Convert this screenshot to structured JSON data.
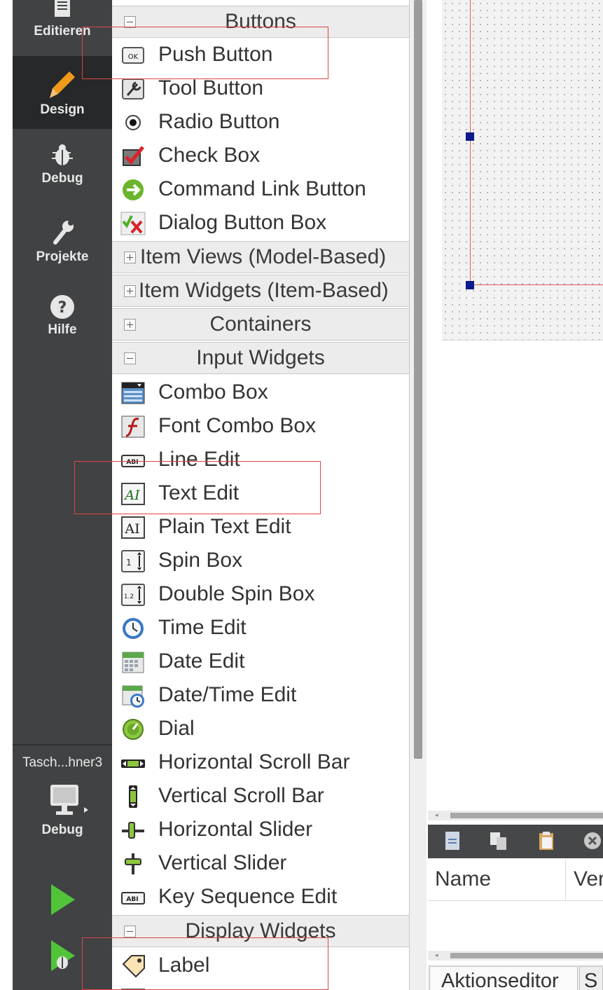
{
  "modes": [
    {
      "label": "Editieren",
      "icon": "document-icon"
    },
    {
      "label": "Design",
      "icon": "pencil-icon"
    },
    {
      "label": "Debug",
      "icon": "bug-icon"
    },
    {
      "label": "Projekte",
      "icon": "wrench-icon"
    },
    {
      "label": "Hilfe",
      "icon": "help-icon"
    }
  ],
  "kit": {
    "project_name": "Tasch...hner3",
    "build_mode": "Debug"
  },
  "widget_box": {
    "categories": {
      "buttons": "Buttons",
      "item_views": "Item Views (Model-Based)",
      "item_widgets": "Item Widgets (Item-Based)",
      "containers": "Containers",
      "input_widgets": "Input Widgets",
      "display_widgets": "Display Widgets"
    },
    "buttons": [
      {
        "label": "Push Button",
        "icon": "push-button-icon"
      },
      {
        "label": "Tool Button",
        "icon": "tool-button-icon"
      },
      {
        "label": "Radio Button",
        "icon": "radio-button-icon"
      },
      {
        "label": "Check Box",
        "icon": "check-box-icon"
      },
      {
        "label": "Command Link Button",
        "icon": "command-link-icon"
      },
      {
        "label": "Dialog Button Box",
        "icon": "dialog-button-box-icon"
      }
    ],
    "input_widgets": [
      {
        "label": "Combo Box",
        "icon": "combo-box-icon"
      },
      {
        "label": "Font Combo Box",
        "icon": "font-combo-box-icon"
      },
      {
        "label": "Line Edit",
        "icon": "line-edit-icon"
      },
      {
        "label": "Text Edit",
        "icon": "text-edit-icon"
      },
      {
        "label": "Plain Text Edit",
        "icon": "plain-text-edit-icon"
      },
      {
        "label": "Spin Box",
        "icon": "spin-box-icon"
      },
      {
        "label": "Double Spin Box",
        "icon": "double-spin-box-icon"
      },
      {
        "label": "Time Edit",
        "icon": "clock-icon"
      },
      {
        "label": "Date Edit",
        "icon": "calendar-icon"
      },
      {
        "label": "Date/Time Edit",
        "icon": "calendar-clock-icon"
      },
      {
        "label": "Dial",
        "icon": "dial-icon"
      },
      {
        "label": "Horizontal Scroll Bar",
        "icon": "horizontal-scrollbar-icon"
      },
      {
        "label": "Vertical Scroll Bar",
        "icon": "vertical-scrollbar-icon"
      },
      {
        "label": "Horizontal Slider",
        "icon": "horizontal-slider-icon"
      },
      {
        "label": "Vertical Slider",
        "icon": "vertical-slider-icon"
      },
      {
        "label": "Key Sequence Edit",
        "icon": "key-sequence-icon"
      }
    ],
    "display_widgets": [
      {
        "label": "Label",
        "icon": "label-tag-icon"
      }
    ],
    "icon_text": {
      "ok": "OK",
      "abi": "ABI",
      "ai": "AI",
      "spin": "1",
      "dspin": "1.2"
    }
  },
  "action_editor": {
    "columns": [
      "Name",
      "Ver"
    ],
    "tabs": [
      "Aktionseditor",
      "S"
    ]
  },
  "colors": {
    "modebar": "#404244",
    "active_mode": "#262829",
    "highlight_box": "#e04444",
    "run_green": "#52c43a",
    "selection_handle": "#0c1a8c"
  }
}
